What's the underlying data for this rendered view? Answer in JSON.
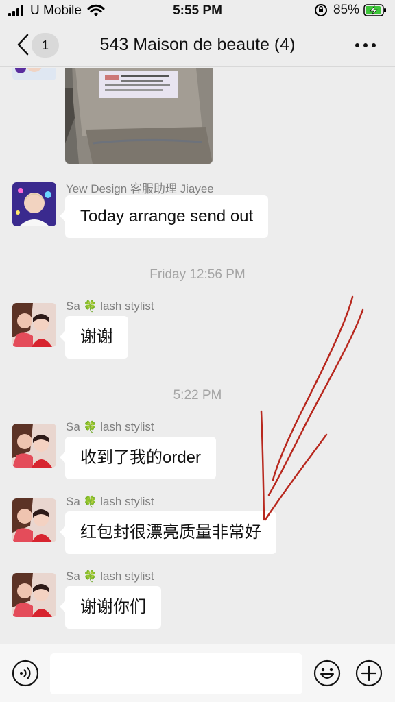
{
  "status_bar": {
    "carrier": "U Mobile",
    "time": "5:55 PM",
    "battery_percent": "85%",
    "icons": [
      "signal-icon",
      "wifi-icon",
      "orientation-lock-icon",
      "battery-charging-icon"
    ]
  },
  "nav": {
    "back_badge": "1",
    "title": "543 Maison de beaute (4)",
    "icons": [
      "back-chevron-icon",
      "more-icon"
    ]
  },
  "messages": [
    {
      "type": "image",
      "description": "parcel-photo"
    },
    {
      "type": "text",
      "sender": "Yew Design 客服助理 Jiayee",
      "text": "Today arrange send out"
    },
    {
      "type": "timestamp",
      "text": "Friday 12:56 PM"
    },
    {
      "type": "text",
      "sender_name": "Sa",
      "sender_emoji": "🍀",
      "sender_suffix": "lash stylist",
      "text": "谢谢"
    },
    {
      "type": "timestamp",
      "text": "5:22 PM"
    },
    {
      "type": "text",
      "sender_name": "Sa",
      "sender_emoji": "🍀",
      "sender_suffix": "lash stylist",
      "text": "收到了我的order"
    },
    {
      "type": "text",
      "sender_name": "Sa",
      "sender_emoji": "🍀",
      "sender_suffix": "lash stylist",
      "text": "红包封很漂亮质量非常好"
    },
    {
      "type": "text",
      "sender_name": "Sa",
      "sender_emoji": "🍀",
      "sender_suffix": "lash stylist",
      "text": "谢谢你们"
    }
  ],
  "input_bar": {
    "placeholder": "",
    "icons": [
      "voice-icon",
      "emoji-icon",
      "plus-icon"
    ]
  },
  "colors": {
    "background": "#ededed",
    "bubble": "#ffffff",
    "annotation_arrow": "#b8281e"
  }
}
